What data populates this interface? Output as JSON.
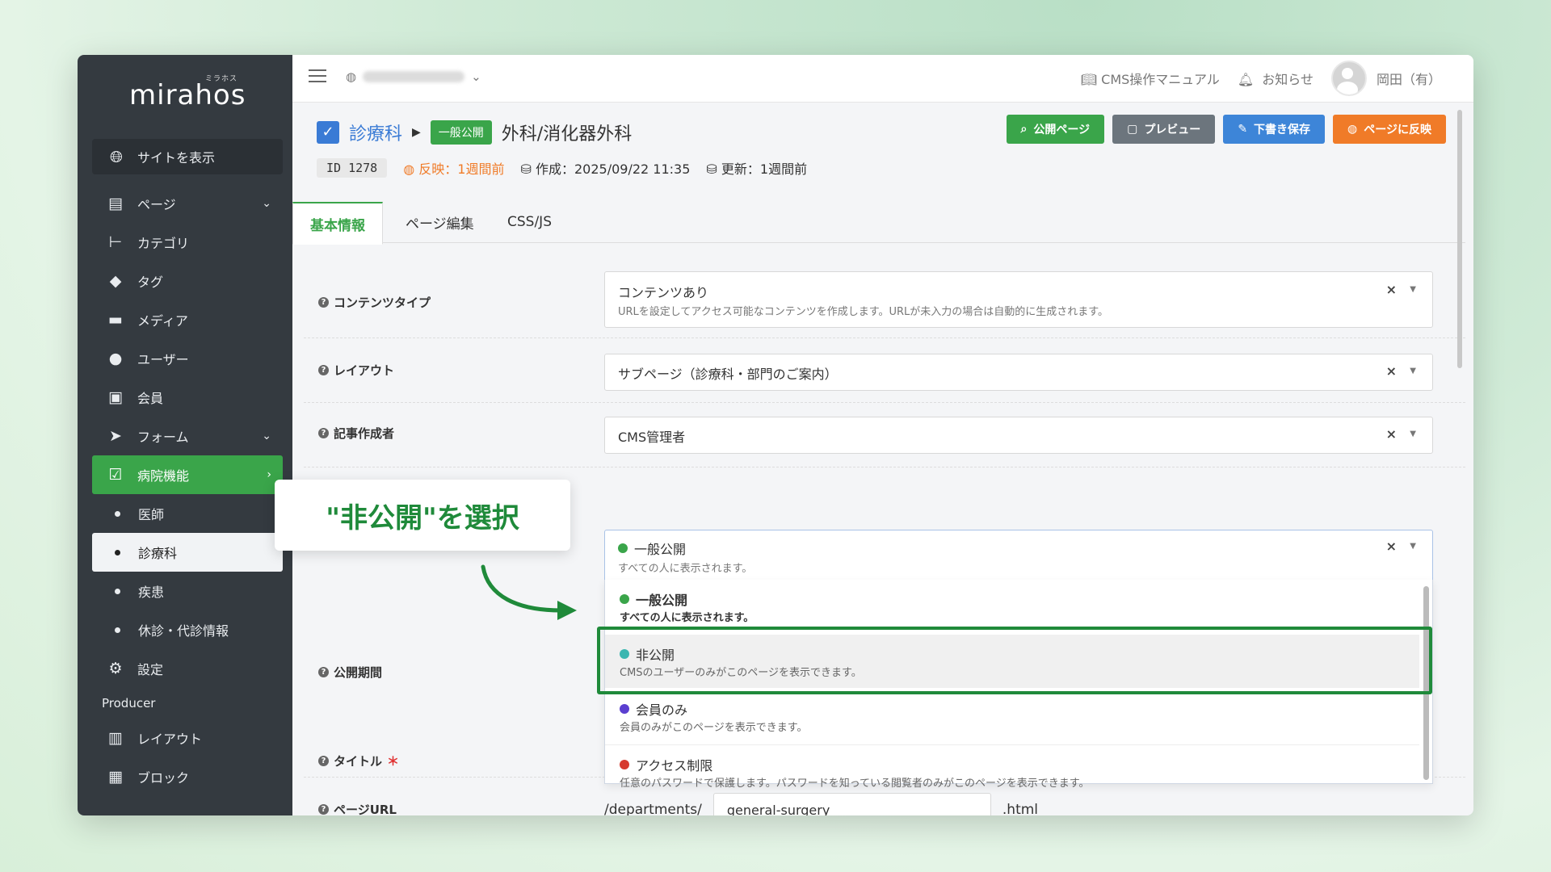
{
  "sidebar": {
    "logo": "mirahos",
    "logo_kana": "ミラホス",
    "site_button": "サイトを表示",
    "items": [
      {
        "label": "ページ",
        "icon": "file-icon"
      },
      {
        "label": "カテゴリ",
        "icon": "tree-icon"
      },
      {
        "label": "タグ",
        "icon": "tag-icon"
      },
      {
        "label": "メディア",
        "icon": "folder-icon"
      },
      {
        "label": "ユーザー",
        "icon": "user-icon"
      },
      {
        "label": "会員",
        "icon": "id-card-icon"
      },
      {
        "label": "フォーム",
        "icon": "send-icon"
      },
      {
        "label": "病院機能",
        "icon": "clipboard-check-icon"
      },
      {
        "label": "医師"
      },
      {
        "label": "診療科"
      },
      {
        "label": "疾患"
      },
      {
        "label": "休診・代診情報"
      },
      {
        "label": "設定",
        "icon": "gear-icon"
      }
    ],
    "producer_label": "Producer",
    "producer_items": [
      {
        "label": "レイアウト",
        "icon": "layout-icon"
      },
      {
        "label": "ブロック",
        "icon": "grid-icon"
      }
    ]
  },
  "topbar": {
    "manual": "CMS操作マニュアル",
    "notice": "お知らせ",
    "user": "岡田（有）"
  },
  "header": {
    "category": "診療科",
    "status_badge": "一般公開",
    "title": "外科/消化器外科",
    "id_label": "ID",
    "id": "1278",
    "reflect": "反映：1週間前",
    "created": "作成：2025/09/22 11:35",
    "updated": "更新：1週間前"
  },
  "actions": {
    "public_page": "公開ページ",
    "preview": "プレビュー",
    "save_draft": "下書き保存",
    "reflect": "ページに反映"
  },
  "tabs": [
    "基本情報",
    "ページ編集",
    "CSS/JS"
  ],
  "form": {
    "content_type": {
      "label": "コンテンツタイプ",
      "value": "コンテンツあり",
      "desc": "URLを設定してアクセス可能なコンテンツを作成します。URLが未入力の場合は自動的に生成されます。"
    },
    "layout": {
      "label": "レイアウト",
      "value": "サブページ（診療科・部門のご案内）"
    },
    "author": {
      "label": "記事作成者",
      "value": "CMS管理者"
    },
    "visibility": {
      "value": "一般公開",
      "desc": "すべての人に表示されます。",
      "color": "#3aa54a"
    },
    "period_label": "公開期間",
    "title_label": "タイトル",
    "required_mark": "＊",
    "url": {
      "label": "ページURL",
      "prefix": "/departments/",
      "value": "general-surgery",
      "suffix": ".html"
    }
  },
  "clear_symbol": "×",
  "dropdown_options": [
    {
      "title": "一般公開",
      "desc": "すべての人に表示されます。",
      "color": "#3aa54a"
    },
    {
      "title": "非公開",
      "desc": "CMSのユーザーのみがこのページを表示できます。",
      "color": "#3bb6b0"
    },
    {
      "title": "会員のみ",
      "desc": "会員のみがこのページを表示できます。",
      "color": "#5b3fd0"
    },
    {
      "title": "アクセス制限",
      "desc": "任意のパスワードで保護します。パスワードを知っている閲覧者のみがこのページを表示できます。",
      "color": "#d63a2f"
    }
  ],
  "callout": "\"非公開\"を選択"
}
